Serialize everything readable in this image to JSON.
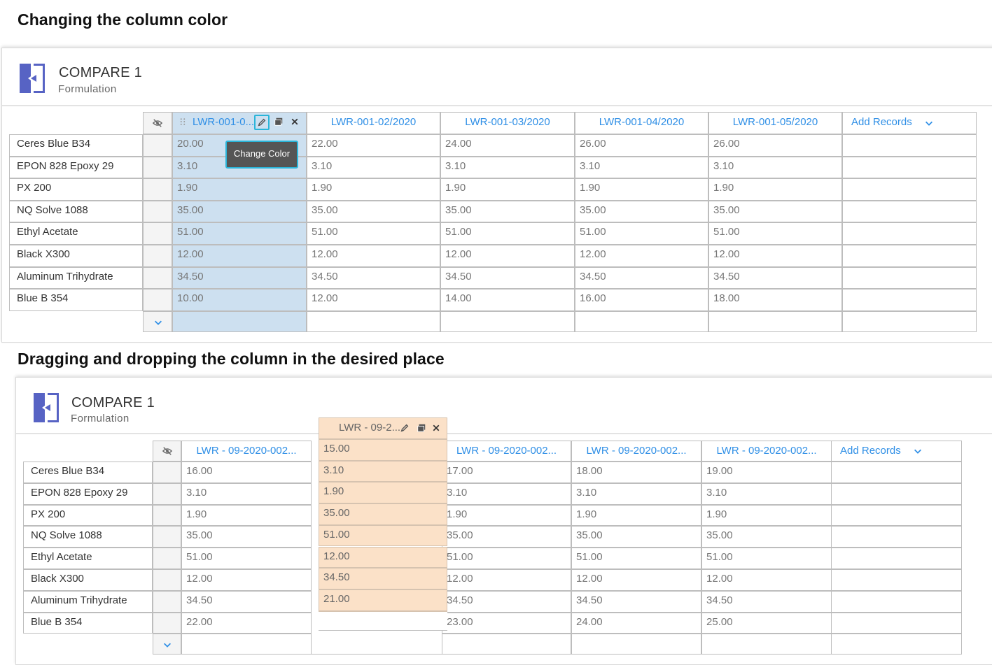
{
  "section1": {
    "title": "Changing the column color",
    "panel_title": "COMPARE 1",
    "panel_subtitle": "Formulation",
    "columns": [
      "LWR-001-0...",
      "LWR-001-02/2020",
      "LWR-001-03/2020",
      "LWR-001-04/2020",
      "LWR-001-05/2020"
    ],
    "add_records": "Add Records",
    "tooltip": "Change Color",
    "selected_color": "#cde0f0",
    "rows": [
      {
        "label": "Ceres Blue B34",
        "values": [
          "20.00",
          "22.00",
          "24.00",
          "26.00",
          "26.00"
        ]
      },
      {
        "label": "EPON 828 Epoxy 29",
        "values": [
          "3.10",
          "3.10",
          "3.10",
          "3.10",
          "3.10"
        ]
      },
      {
        "label": "PX 200",
        "values": [
          "1.90",
          "1.90",
          "1.90",
          "1.90",
          "1.90"
        ]
      },
      {
        "label": "NQ Solve 1088",
        "values": [
          "35.00",
          "35.00",
          "35.00",
          "35.00",
          "35.00"
        ]
      },
      {
        "label": "Ethyl Acetate",
        "values": [
          "51.00",
          "51.00",
          "51.00",
          "51.00",
          "51.00"
        ]
      },
      {
        "label": "Black X300",
        "values": [
          "12.00",
          "12.00",
          "12.00",
          "12.00",
          "12.00"
        ]
      },
      {
        "label": "Aluminum Trihydrate",
        "values": [
          "34.50",
          "34.50",
          "34.50",
          "34.50",
          "34.50"
        ]
      },
      {
        "label": "Blue B 354",
        "values": [
          "10.00",
          "12.00",
          "14.00",
          "16.00",
          "18.00"
        ]
      }
    ]
  },
  "section2": {
    "title": "Dragging and dropping the column in the desired place",
    "panel_title": "COMPARE 1",
    "panel_subtitle": "Formulation",
    "columns": [
      "LWR - 09-2020-002...",
      "LWR - 09-2020-002...",
      "LWR - 09-2020-002...",
      "LWR - 09-2020-002..."
    ],
    "add_records": "Add Records",
    "dragged_column": "LWR - 09-2...",
    "dragged_values": [
      "15.00",
      "3.10",
      "1.90",
      "35.00",
      "51.00",
      "12.00",
      "34.50",
      "21.00"
    ],
    "drag_color": "#fbe1c8",
    "rows": [
      {
        "label": "Ceres Blue B34",
        "values": [
          "16.00",
          "17.00",
          "18.00",
          "19.00"
        ]
      },
      {
        "label": "EPON 828 Epoxy 29",
        "values": [
          "3.10",
          "3.10",
          "3.10",
          "3.10"
        ]
      },
      {
        "label": "PX 200",
        "values": [
          "1.90",
          "1.90",
          "1.90",
          "1.90"
        ]
      },
      {
        "label": "NQ Solve 1088",
        "values": [
          "35.00",
          "35.00",
          "35.00",
          "35.00"
        ]
      },
      {
        "label": "Ethyl Acetate",
        "values": [
          "51.00",
          "51.00",
          "51.00",
          "51.00"
        ]
      },
      {
        "label": "Black X300",
        "values": [
          "12.00",
          "12.00",
          "12.00",
          "12.00"
        ]
      },
      {
        "label": "Aluminum Trihydrate",
        "values": [
          "34.50",
          "34.50",
          "34.50",
          "34.50"
        ]
      },
      {
        "label": "Blue B 354",
        "values": [
          "22.00",
          "23.00",
          "24.00",
          "25.00"
        ]
      }
    ]
  }
}
